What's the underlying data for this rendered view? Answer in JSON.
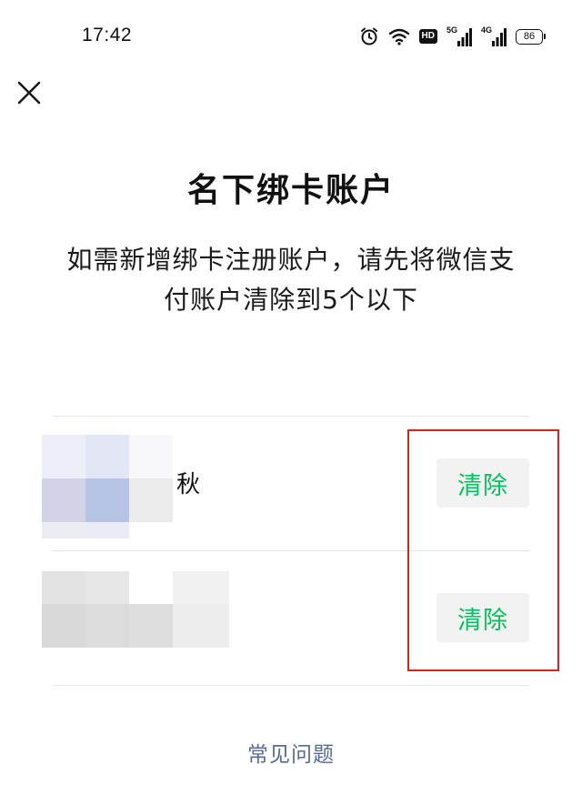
{
  "status_bar": {
    "time": "17:42",
    "icons": [
      "alarm-icon",
      "wifi-icon",
      "hd-icon",
      "signal-5g-icon",
      "signal-4g-icon",
      "battery-icon"
    ],
    "hd_label": "HD",
    "net_5g_label": "5G",
    "net_4g_label": "4G",
    "battery_level": "86"
  },
  "close": {
    "icon": "close-icon"
  },
  "page": {
    "title": "名下绑卡账户",
    "description": "如需新增绑卡注册账户，请先将微信支付账户清除到5个以下"
  },
  "accounts": [
    {
      "name": "秋",
      "clear_label": "清除",
      "avatar_icon": "blurred-avatar",
      "mosaic_colors": [
        "#eceef8",
        "#e3e7f5",
        "#f8f8fa",
        "#d3d3e8",
        "#b7c3e5",
        "#ebebec",
        "#ececf3",
        "#eaebf4",
        "#ffffff"
      ]
    },
    {
      "name": "",
      "clear_label": "清除",
      "avatar_icon": "blurred-avatar",
      "mosaic_colors": [
        "#e3e3e3",
        "#e6e6e6",
        "#ffffff",
        "#f1f1f1",
        "#d9d9d9",
        "#dcdcdc",
        "#dedede",
        "#ededed",
        "#f3f3f3"
      ]
    }
  ],
  "footer": {
    "faq_label": "常见问题"
  },
  "colors": {
    "accent_green": "#07c160",
    "link_blue": "#576b95",
    "highlight_red": "#e02020"
  }
}
